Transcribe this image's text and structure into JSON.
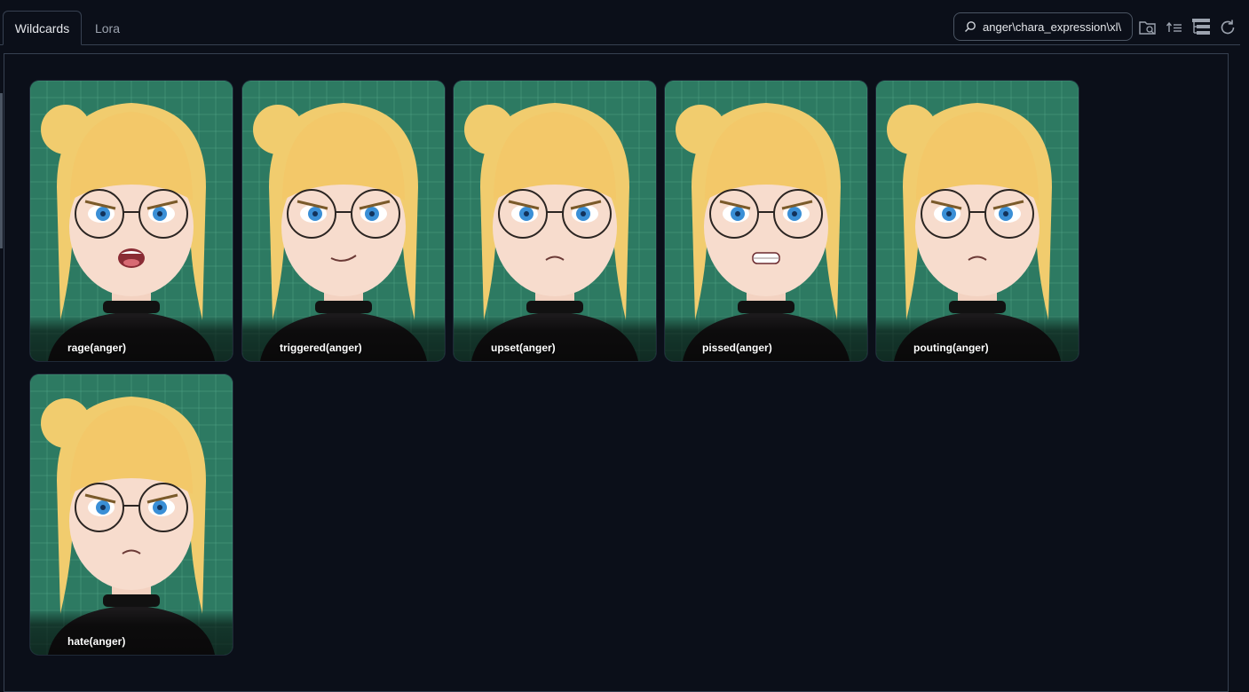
{
  "tabs": [
    {
      "label": "Wildcards",
      "active": true
    },
    {
      "label": "Lora",
      "active": false
    }
  ],
  "search": {
    "value": "\\anger\\chara_expression\\xl"
  },
  "toolbar": {
    "icons": [
      "folder-search-icon",
      "sort-icon",
      "tree-view-icon",
      "refresh-icon"
    ]
  },
  "colors": {
    "background": "#0b0f19",
    "border": "#374151",
    "card_green": "#2d7a62",
    "hair": "#f1cc6e",
    "eyes": "#3a8fd6"
  },
  "cards": [
    {
      "label": "rage(anger)",
      "mouth": "open"
    },
    {
      "label": "triggered(anger)",
      "mouth": "smirk"
    },
    {
      "label": "upset(anger)",
      "mouth": "frown"
    },
    {
      "label": "pissed(anger)",
      "mouth": "teeth"
    },
    {
      "label": "pouting(anger)",
      "mouth": "frown"
    },
    {
      "label": "hate(anger)",
      "mouth": "frown"
    }
  ]
}
